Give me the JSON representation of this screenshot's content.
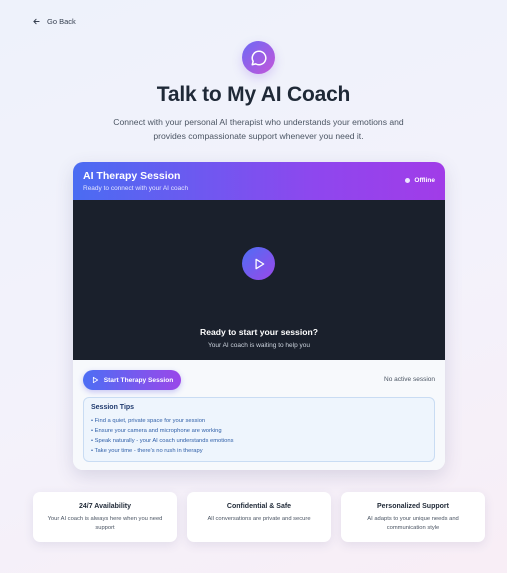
{
  "nav": {
    "back_label": "Go Back"
  },
  "hero": {
    "title": "Talk to My AI Coach",
    "subtitle": "Connect with your personal AI therapist who understands your emotions and provides compassionate support whenever you need it."
  },
  "session_card": {
    "title": "AI Therapy Session",
    "subtitle": "Ready to connect with your AI coach",
    "status": "Offline",
    "video": {
      "title": "Ready to start your session?",
      "subtitle": "Your AI coach is waiting to help you"
    },
    "start_button": "Start Therapy Session",
    "session_state": "No active session",
    "tips": {
      "title": "Session Tips",
      "items": [
        "Find a quiet, private space for your session",
        "Ensure your camera and microphone are working",
        "Speak naturally - your AI coach understands emotions",
        "Take your time - there's no rush in therapy"
      ]
    }
  },
  "features": [
    {
      "title": "24/7 Availability",
      "description": "Your AI coach is always here when you need support"
    },
    {
      "title": "Confidential & Safe",
      "description": "All conversations are private and secure"
    },
    {
      "title": "Personalized Support",
      "description": "AI adapts to your unique needs and communication style"
    }
  ],
  "colors": {
    "accent_start": "#4a6cf2",
    "accent_end": "#a13ce8",
    "video_bg": "#1a202c",
    "tips_bg": "#eef5fd"
  },
  "icons": {
    "back": "arrow-left-icon",
    "logo": "chat-bubble-icon",
    "play": "play-icon"
  }
}
